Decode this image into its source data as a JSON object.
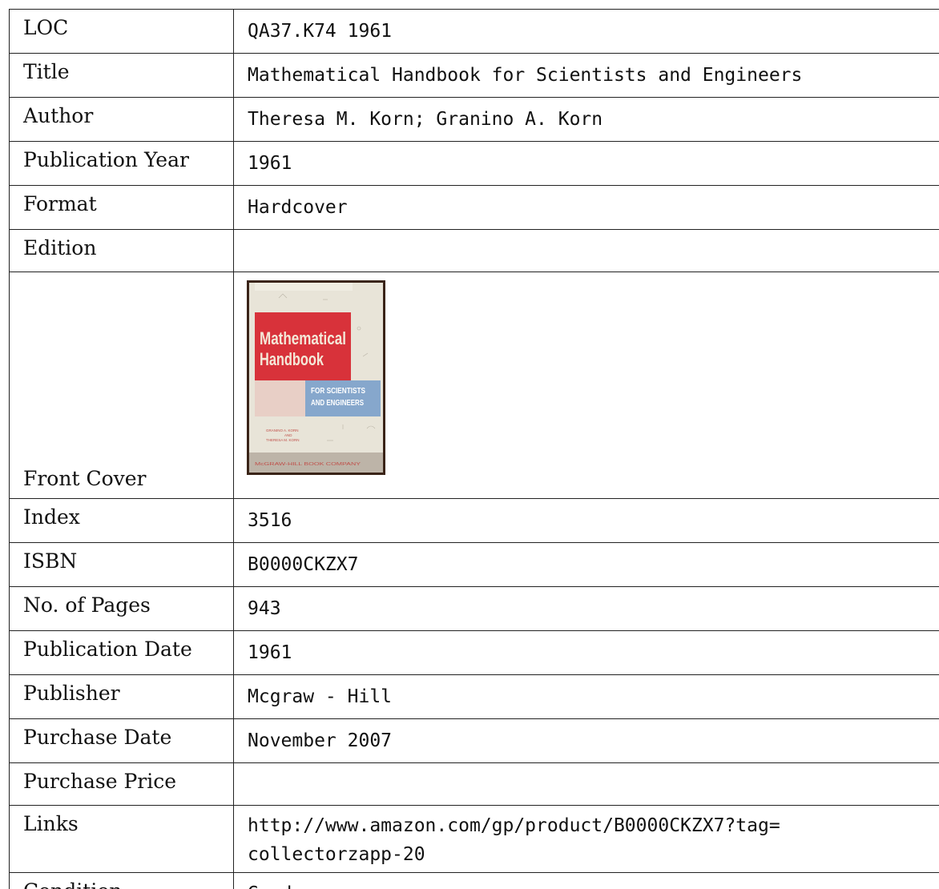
{
  "rows": [
    {
      "label": "LOC",
      "value": "QA37.K74 1961"
    },
    {
      "label": "Title",
      "value": "Mathematical Handbook for Scientists and Engineers"
    },
    {
      "label": "Author",
      "value": "Theresa M. Korn; Granino A. Korn"
    },
    {
      "label": "Publication Year",
      "value": "1961"
    },
    {
      "label": "Format",
      "value": "Hardcover"
    },
    {
      "label": "Edition",
      "value": ""
    },
    {
      "label": "Front Cover",
      "value": ""
    },
    {
      "label": "Index",
      "value": "3516"
    },
    {
      "label": "ISBN",
      "value": "B0000CKZX7"
    },
    {
      "label": "No. of Pages",
      "value": "943"
    },
    {
      "label": "Publication Date",
      "value": "1961"
    },
    {
      "label": "Publisher",
      "value": "Mcgraw - Hill"
    },
    {
      "label": "Purchase Date",
      "value": "November 2007"
    },
    {
      "label": "Purchase Price",
      "value": ""
    },
    {
      "label": "Links",
      "value_line1": "http://www.amazon.com/gp/product/B0000CKZX7?tag=",
      "value_line2": "collectorzapp-20"
    },
    {
      "label": "Condition",
      "value": "Good"
    }
  ],
  "cover": {
    "title_line1": "Mathematical",
    "title_line2": "Handbook",
    "subtitle_line1": "FOR SCIENTISTS",
    "subtitle_line2": "AND ENGINEERS",
    "author_line1": "GRANINO A. KORN",
    "author_line2": "AND",
    "author_line3": "THERESA M. KORN",
    "publisher": "McGRAW-HILL BOOK COMPANY",
    "colors": {
      "frame": "#3a2418",
      "paper": "#e8e4d8",
      "red": "#d8323a",
      "blue": "#86a7cc",
      "pink": "#e8cfc6"
    }
  }
}
